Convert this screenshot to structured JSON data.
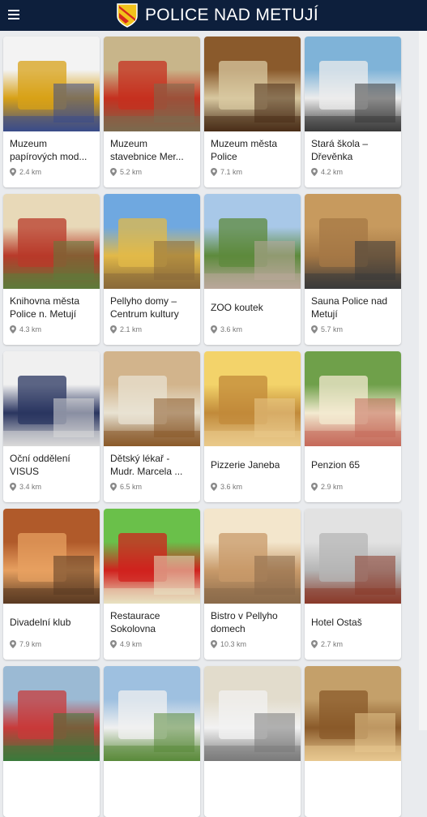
{
  "app": {
    "title": "POLICE NAD METUJÍ",
    "menu_icon": "hamburger-icon",
    "crest_icon": "coat-of-arms-icon",
    "colors": {
      "header": "#0d1f3c",
      "crest_yellow": "#f2c21b",
      "crest_red": "#d62a1e"
    }
  },
  "places": [
    {
      "name": "Muzeum papírových mod...",
      "distance": "2.4 km",
      "colors": [
        "#f3f3f3",
        "#d8a117",
        "#3a4b8a"
      ]
    },
    {
      "name": "Muzeum stavebnice Mer...",
      "distance": "5.2 km",
      "colors": [
        "#c8b58a",
        "#c5301f",
        "#7b6a4e"
      ]
    },
    {
      "name": "Muzeum města Police",
      "distance": "7.1 km",
      "colors": [
        "#8a5a2c",
        "#d8c8a0",
        "#4a2e18"
      ]
    },
    {
      "name": "Stará škola – Dřevěnka",
      "distance": "4.2 km",
      "colors": [
        "#7fb3d8",
        "#ececec",
        "#3a3a3a"
      ]
    },
    {
      "name": "Knihovna města Police n. Metují",
      "distance": "4.3 km",
      "colors": [
        "#e8d9b8",
        "#b83a2a",
        "#5e7a3a"
      ]
    },
    {
      "name": "Pellyho domy – Centrum kultury",
      "distance": "2.1 km",
      "colors": [
        "#6fa8e0",
        "#e2b948",
        "#8a6a3a"
      ]
    },
    {
      "name": "ZOO koutek",
      "distance": "3.6 km",
      "colors": [
        "#a8c8e8",
        "#5d8a3c",
        "#b9a79a"
      ]
    },
    {
      "name": "Sauna Police nad Metují",
      "distance": "5.7 km",
      "colors": [
        "#c79a5e",
        "#a57845",
        "#3a3a3a"
      ]
    },
    {
      "name": "Oční oddělení VISUS",
      "distance": "3.4 km",
      "colors": [
        "#f0f0f0",
        "#2a3560",
        "#d9d9d9"
      ]
    },
    {
      "name": "Dětský lékař - Mudr. Marcela ...",
      "distance": "6.5 km",
      "colors": [
        "#d2b48c",
        "#e8e2d2",
        "#8a5a2a"
      ]
    },
    {
      "name": "Pizzerie Janeba",
      "distance": "3.6 km",
      "colors": [
        "#f3d36a",
        "#c18a3a",
        "#e9c98a"
      ]
    },
    {
      "name": "Penzion 65",
      "distance": "2.9 km",
      "colors": [
        "#6fa04a",
        "#f3ead0",
        "#c56a5a"
      ]
    },
    {
      "name": "Divadelní klub",
      "distance": "7.9 km",
      "colors": [
        "#b05a2a",
        "#e7a060",
        "#5a3a22"
      ]
    },
    {
      "name": "Restaurace Sokolovna",
      "distance": "4.9 km",
      "colors": [
        "#6ac04a",
        "#d0221e",
        "#e8e2c2"
      ]
    },
    {
      "name": "Bistro v Pellyho domech",
      "distance": "10.3 km",
      "colors": [
        "#f3e6cc",
        "#c89a6a",
        "#8a6a4a"
      ]
    },
    {
      "name": "Hotel Ostaš",
      "distance": "2.7 km",
      "colors": [
        "#e2e2e2",
        "#b5b5b5",
        "#8a3a2a"
      ]
    },
    {
      "name": "",
      "distance": "",
      "colors": [
        "#9bbad4",
        "#c83a3a",
        "#3a7a3a"
      ]
    },
    {
      "name": "",
      "distance": "",
      "colors": [
        "#9ec0e0",
        "#f0f0f0",
        "#5a8a3a"
      ]
    },
    {
      "name": "",
      "distance": "",
      "colors": [
        "#e2dccc",
        "#f2f2f2",
        "#7a7a7a"
      ]
    },
    {
      "name": "",
      "distance": "",
      "colors": [
        "#c4a06a",
        "#8a5a2a",
        "#e8c890"
      ]
    }
  ]
}
